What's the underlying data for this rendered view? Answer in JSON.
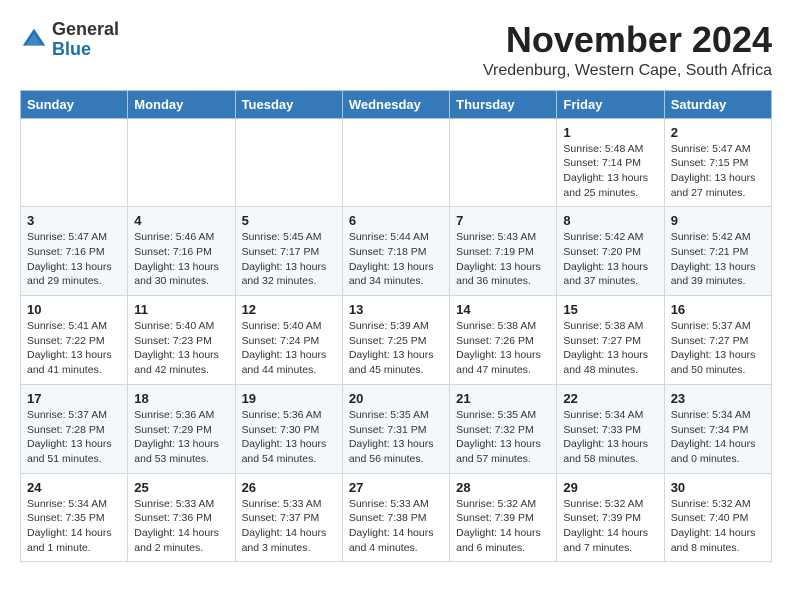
{
  "logo": {
    "general": "General",
    "blue": "Blue"
  },
  "header": {
    "month_year": "November 2024",
    "location": "Vredenburg, Western Cape, South Africa"
  },
  "days_of_week": [
    "Sunday",
    "Monday",
    "Tuesday",
    "Wednesday",
    "Thursday",
    "Friday",
    "Saturday"
  ],
  "weeks": [
    [
      {
        "day": "",
        "info": ""
      },
      {
        "day": "",
        "info": ""
      },
      {
        "day": "",
        "info": ""
      },
      {
        "day": "",
        "info": ""
      },
      {
        "day": "",
        "info": ""
      },
      {
        "day": "1",
        "info": "Sunrise: 5:48 AM\nSunset: 7:14 PM\nDaylight: 13 hours\nand 25 minutes."
      },
      {
        "day": "2",
        "info": "Sunrise: 5:47 AM\nSunset: 7:15 PM\nDaylight: 13 hours\nand 27 minutes."
      }
    ],
    [
      {
        "day": "3",
        "info": "Sunrise: 5:47 AM\nSunset: 7:16 PM\nDaylight: 13 hours\nand 29 minutes."
      },
      {
        "day": "4",
        "info": "Sunrise: 5:46 AM\nSunset: 7:16 PM\nDaylight: 13 hours\nand 30 minutes."
      },
      {
        "day": "5",
        "info": "Sunrise: 5:45 AM\nSunset: 7:17 PM\nDaylight: 13 hours\nand 32 minutes."
      },
      {
        "day": "6",
        "info": "Sunrise: 5:44 AM\nSunset: 7:18 PM\nDaylight: 13 hours\nand 34 minutes."
      },
      {
        "day": "7",
        "info": "Sunrise: 5:43 AM\nSunset: 7:19 PM\nDaylight: 13 hours\nand 36 minutes."
      },
      {
        "day": "8",
        "info": "Sunrise: 5:42 AM\nSunset: 7:20 PM\nDaylight: 13 hours\nand 37 minutes."
      },
      {
        "day": "9",
        "info": "Sunrise: 5:42 AM\nSunset: 7:21 PM\nDaylight: 13 hours\nand 39 minutes."
      }
    ],
    [
      {
        "day": "10",
        "info": "Sunrise: 5:41 AM\nSunset: 7:22 PM\nDaylight: 13 hours\nand 41 minutes."
      },
      {
        "day": "11",
        "info": "Sunrise: 5:40 AM\nSunset: 7:23 PM\nDaylight: 13 hours\nand 42 minutes."
      },
      {
        "day": "12",
        "info": "Sunrise: 5:40 AM\nSunset: 7:24 PM\nDaylight: 13 hours\nand 44 minutes."
      },
      {
        "day": "13",
        "info": "Sunrise: 5:39 AM\nSunset: 7:25 PM\nDaylight: 13 hours\nand 45 minutes."
      },
      {
        "day": "14",
        "info": "Sunrise: 5:38 AM\nSunset: 7:26 PM\nDaylight: 13 hours\nand 47 minutes."
      },
      {
        "day": "15",
        "info": "Sunrise: 5:38 AM\nSunset: 7:27 PM\nDaylight: 13 hours\nand 48 minutes."
      },
      {
        "day": "16",
        "info": "Sunrise: 5:37 AM\nSunset: 7:27 PM\nDaylight: 13 hours\nand 50 minutes."
      }
    ],
    [
      {
        "day": "17",
        "info": "Sunrise: 5:37 AM\nSunset: 7:28 PM\nDaylight: 13 hours\nand 51 minutes."
      },
      {
        "day": "18",
        "info": "Sunrise: 5:36 AM\nSunset: 7:29 PM\nDaylight: 13 hours\nand 53 minutes."
      },
      {
        "day": "19",
        "info": "Sunrise: 5:36 AM\nSunset: 7:30 PM\nDaylight: 13 hours\nand 54 minutes."
      },
      {
        "day": "20",
        "info": "Sunrise: 5:35 AM\nSunset: 7:31 PM\nDaylight: 13 hours\nand 56 minutes."
      },
      {
        "day": "21",
        "info": "Sunrise: 5:35 AM\nSunset: 7:32 PM\nDaylight: 13 hours\nand 57 minutes."
      },
      {
        "day": "22",
        "info": "Sunrise: 5:34 AM\nSunset: 7:33 PM\nDaylight: 13 hours\nand 58 minutes."
      },
      {
        "day": "23",
        "info": "Sunrise: 5:34 AM\nSunset: 7:34 PM\nDaylight: 14 hours\nand 0 minutes."
      }
    ],
    [
      {
        "day": "24",
        "info": "Sunrise: 5:34 AM\nSunset: 7:35 PM\nDaylight: 14 hours\nand 1 minute."
      },
      {
        "day": "25",
        "info": "Sunrise: 5:33 AM\nSunset: 7:36 PM\nDaylight: 14 hours\nand 2 minutes."
      },
      {
        "day": "26",
        "info": "Sunrise: 5:33 AM\nSunset: 7:37 PM\nDaylight: 14 hours\nand 3 minutes."
      },
      {
        "day": "27",
        "info": "Sunrise: 5:33 AM\nSunset: 7:38 PM\nDaylight: 14 hours\nand 4 minutes."
      },
      {
        "day": "28",
        "info": "Sunrise: 5:32 AM\nSunset: 7:39 PM\nDaylight: 14 hours\nand 6 minutes."
      },
      {
        "day": "29",
        "info": "Sunrise: 5:32 AM\nSunset: 7:39 PM\nDaylight: 14 hours\nand 7 minutes."
      },
      {
        "day": "30",
        "info": "Sunrise: 5:32 AM\nSunset: 7:40 PM\nDaylight: 14 hours\nand 8 minutes."
      }
    ]
  ]
}
